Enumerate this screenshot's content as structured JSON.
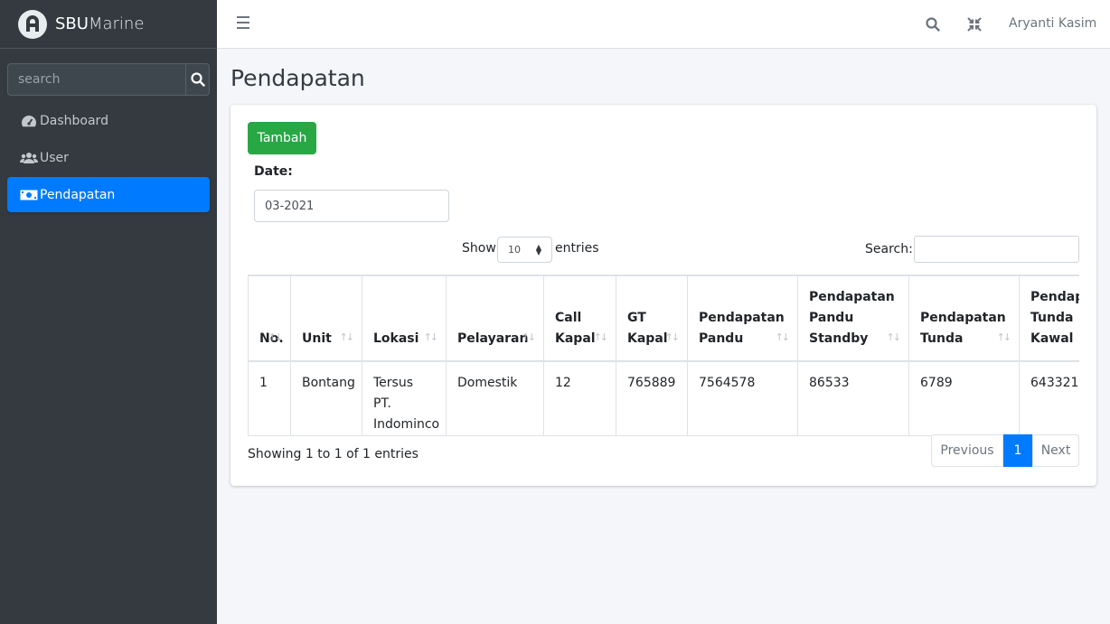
{
  "brand": {
    "name_bold": "SBU",
    "name_light": "Marine"
  },
  "sidebar": {
    "search_placeholder": "search",
    "items": [
      {
        "label": "Dashboard",
        "icon": "tachometer-icon",
        "active": false
      },
      {
        "label": "User",
        "icon": "users-icon",
        "active": false
      },
      {
        "label": "Pendapatan",
        "icon": "money-bill-icon",
        "active": true
      }
    ]
  },
  "topbar": {
    "user_name": "Aryanti Kasim"
  },
  "page": {
    "title": "Pendapatan"
  },
  "form": {
    "add_label": "Tambah",
    "date_label": "Date:",
    "date_value": "03-2021"
  },
  "table_controls": {
    "show_label": "Show",
    "page_length": "10",
    "entries_label": "entries",
    "search_label": "Search:"
  },
  "table": {
    "columns": [
      "No.",
      "Unit",
      "Lokasi",
      "Pelayaran",
      "Call Kapal",
      "GT Kapal",
      "Pendapatan Pandu",
      "Pendapatan Pandu Standby",
      "Pendapatan Tunda",
      "Pendapatan Tunda Kawal"
    ],
    "rows": [
      [
        "1",
        "Bontang",
        "Tersus PT. Indominco",
        "Domestik",
        "12",
        "765889",
        "7564578",
        "86533",
        "6789",
        "643321"
      ]
    ]
  },
  "footer": {
    "info": "Showing 1 to 1 of 1 entries",
    "prev": "Previous",
    "current_page": "1",
    "next": "Next"
  },
  "colors": {
    "primary": "#007bff",
    "success": "#28a745",
    "sidebar": "#343a40"
  }
}
